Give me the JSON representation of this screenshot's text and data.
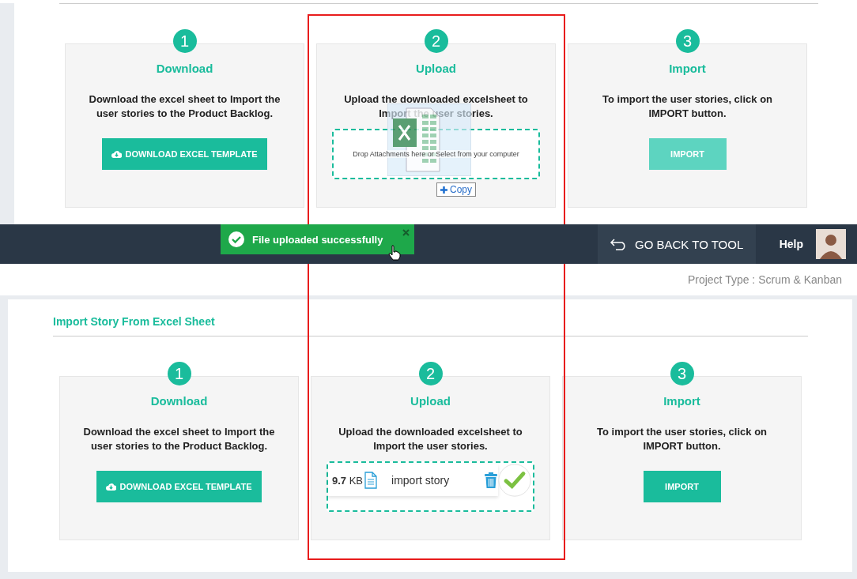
{
  "top_panel": {
    "steps": [
      {
        "number": "1",
        "title": "Download",
        "description": "Download the excel sheet to Import the user stories to the Product Backlog.",
        "kind": "button",
        "action": {
          "label": "DOWNLOAD EXCEL TEMPLATE",
          "kind": "download",
          "disabled": false
        }
      },
      {
        "number": "2",
        "title": "Upload",
        "description": "Upload the downloaded excelsheet to Import the user stories.",
        "kind": "dropzone",
        "dropzone": {
          "placeholder": "Drop Attachments here or Select from your computer"
        }
      },
      {
        "number": "3",
        "title": "Import",
        "description": "To import the user stories, click on IMPORT button.",
        "kind": "button",
        "action": {
          "label": "IMPORT",
          "kind": "import",
          "disabled": true
        }
      }
    ]
  },
  "drag_overlay": {
    "copy_label": "Copy"
  },
  "nav_bar": {
    "toast": {
      "message": "File uploaded successfully"
    },
    "back_button": "GO BACK TO TOOL",
    "help": "Help"
  },
  "project_type": "Project Type : Scrum & Kanban",
  "bottom_panel": {
    "title": "Import Story From Excel Sheet",
    "steps": [
      {
        "number": "1",
        "title": "Download",
        "description": "Download the excel sheet to Import the user stories to the Product Backlog.",
        "kind": "button",
        "action": {
          "label": "DOWNLOAD EXCEL TEMPLATE",
          "kind": "download",
          "disabled": false
        }
      },
      {
        "number": "2",
        "title": "Upload",
        "description": "Upload the downloaded excelsheet to Import the user stories.",
        "kind": "file",
        "file": {
          "size": "**9.7** KB",
          "name": "import story"
        }
      },
      {
        "number": "3",
        "title": "Import",
        "description": "To import the user stories, click on IMPORT button.",
        "kind": "button",
        "action": {
          "label": "IMPORT",
          "kind": "import",
          "disabled": false
        }
      }
    ]
  }
}
